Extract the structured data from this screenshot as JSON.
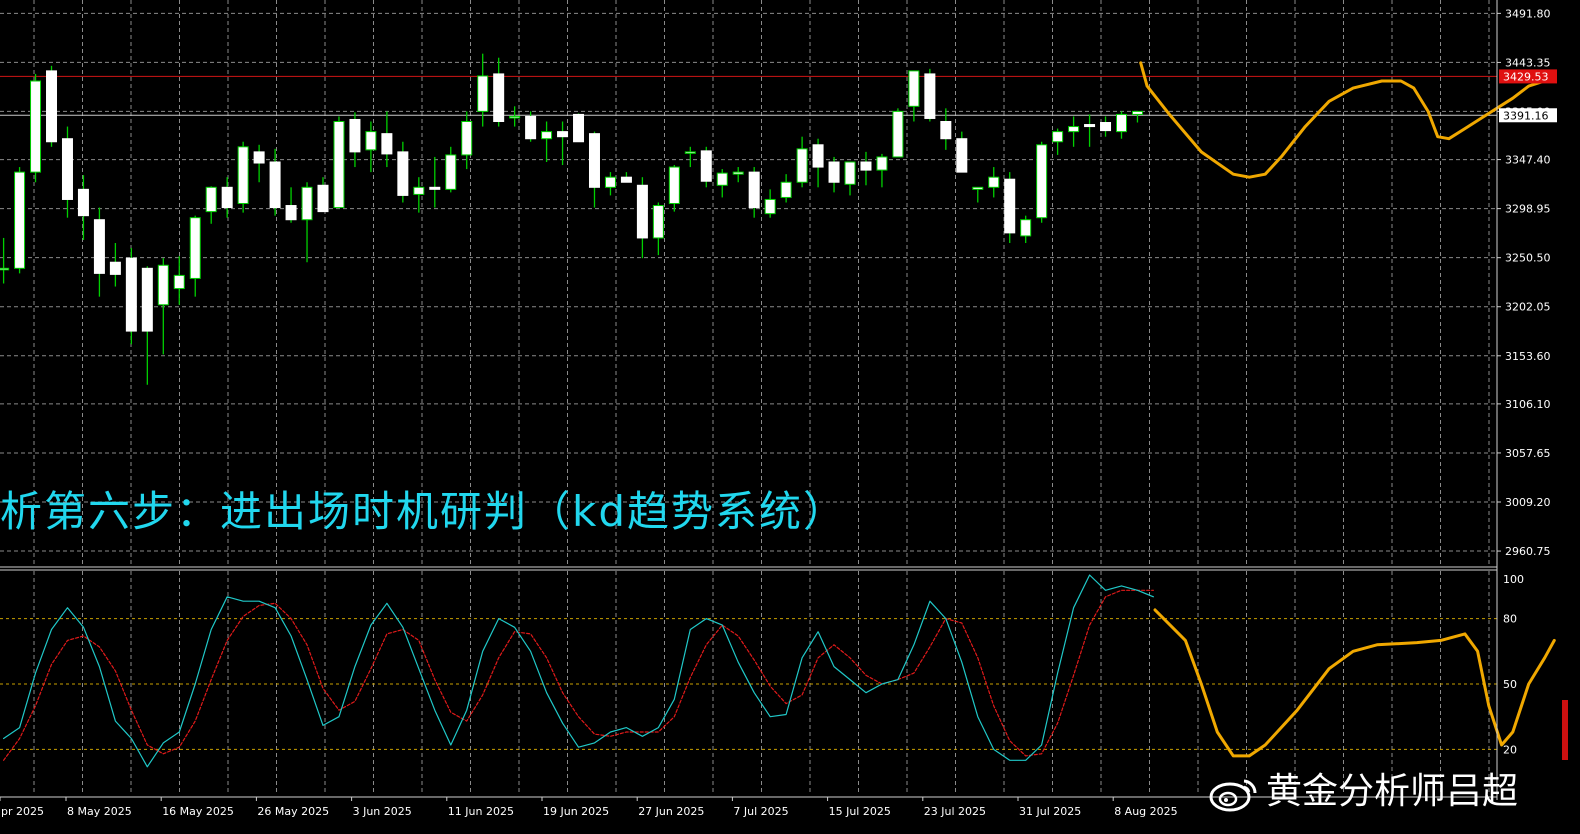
{
  "caption": "析第六步：进出场时机研判（kd趋势系统）",
  "watermark": "黄金分析师吕超",
  "watermark_logo": "weibo-logo",
  "colors": {
    "background": "#000000",
    "grid": "#8a8a8a",
    "bull_candle": "#ffffff",
    "bear_candle": "#ffffff",
    "wick": "#00d000",
    "resistance_line": "#d01414",
    "current_price_line": "#c8c8c8",
    "projection": "#f0a800",
    "k_line": "#20c8c8",
    "d_line": "#e01a1a",
    "caption": "#21d7ee"
  },
  "chart_data": [
    {
      "type": "candlestick",
      "y_ticks": [
        "3491.80",
        "3443.35",
        "3395.00",
        "3347.40",
        "3298.95",
        "3250.50",
        "3202.05",
        "3153.60",
        "3106.10",
        "3057.65",
        "3009.20",
        "2960.75"
      ],
      "ylim": [
        2945,
        3505
      ],
      "price_labels": [
        {
          "value": 3429.53,
          "text": "3429.53",
          "kind": "resistance"
        },
        {
          "value": 3391.16,
          "text": "3391.16",
          "kind": "current"
        }
      ],
      "x_labels": [
        "pr 2025",
        "8 May 2025",
        "16 May 2025",
        "26 May 2025",
        "3 Jun 2025",
        "11 Jun 2025",
        "19 Jun 2025",
        "27 Jun 2025",
        "7 Jul 2025",
        "15 Jul 2025",
        "23 Jul 2025",
        "31 Jul 2025",
        "8 Aug 2025"
      ],
      "candles": [
        {
          "o": 3240,
          "h": 3270,
          "l": 3225,
          "c": 3240
        },
        {
          "o": 3240,
          "h": 3340,
          "l": 3235,
          "c": 3335
        },
        {
          "o": 3335,
          "h": 3432,
          "l": 3325,
          "c": 3425
        },
        {
          "o": 3435,
          "h": 3440,
          "l": 3360,
          "c": 3365
        },
        {
          "o": 3368,
          "h": 3380,
          "l": 3290,
          "c": 3308
        },
        {
          "o": 3318,
          "h": 3332,
          "l": 3268,
          "c": 3292
        },
        {
          "o": 3288,
          "h": 3300,
          "l": 3212,
          "c": 3235
        },
        {
          "o": 3246,
          "h": 3265,
          "l": 3222,
          "c": 3234
        },
        {
          "o": 3250,
          "h": 3260,
          "l": 3165,
          "c": 3178
        },
        {
          "o": 3240,
          "h": 3242,
          "l": 3125,
          "c": 3178
        },
        {
          "o": 3204,
          "h": 3250,
          "l": 3155,
          "c": 3243
        },
        {
          "o": 3220,
          "h": 3252,
          "l": 3204,
          "c": 3233
        },
        {
          "o": 3230,
          "h": 3292,
          "l": 3212,
          "c": 3290
        },
        {
          "o": 3296,
          "h": 3321,
          "l": 3284,
          "c": 3320
        },
        {
          "o": 3320,
          "h": 3330,
          "l": 3290,
          "c": 3300
        },
        {
          "o": 3304,
          "h": 3365,
          "l": 3295,
          "c": 3360
        },
        {
          "o": 3355,
          "h": 3362,
          "l": 3325,
          "c": 3344
        },
        {
          "o": 3345,
          "h": 3358,
          "l": 3292,
          "c": 3300
        },
        {
          "o": 3302,
          "h": 3320,
          "l": 3285,
          "c": 3288
        },
        {
          "o": 3288,
          "h": 3325,
          "l": 3246,
          "c": 3320
        },
        {
          "o": 3322,
          "h": 3330,
          "l": 3296,
          "c": 3296
        },
        {
          "o": 3300,
          "h": 3390,
          "l": 3300,
          "c": 3385
        },
        {
          "o": 3387,
          "h": 3394,
          "l": 3340,
          "c": 3355
        },
        {
          "o": 3357,
          "h": 3385,
          "l": 3335,
          "c": 3375
        },
        {
          "o": 3373,
          "h": 3395,
          "l": 3340,
          "c": 3353
        },
        {
          "o": 3355,
          "h": 3365,
          "l": 3305,
          "c": 3312
        },
        {
          "o": 3313,
          "h": 3330,
          "l": 3295,
          "c": 3320
        },
        {
          "o": 3320,
          "h": 3350,
          "l": 3300,
          "c": 3318
        },
        {
          "o": 3318,
          "h": 3360,
          "l": 3315,
          "c": 3352
        },
        {
          "o": 3352,
          "h": 3395,
          "l": 3338,
          "c": 3385
        },
        {
          "o": 3395,
          "h": 3452,
          "l": 3380,
          "c": 3430
        },
        {
          "o": 3432,
          "h": 3448,
          "l": 3380,
          "c": 3385
        },
        {
          "o": 3390,
          "h": 3400,
          "l": 3380,
          "c": 3390
        },
        {
          "o": 3390,
          "h": 3395,
          "l": 3365,
          "c": 3368
        },
        {
          "o": 3368,
          "h": 3385,
          "l": 3345,
          "c": 3375
        },
        {
          "o": 3375,
          "h": 3385,
          "l": 3342,
          "c": 3370
        },
        {
          "o": 3392,
          "h": 3393,
          "l": 3365,
          "c": 3365
        },
        {
          "o": 3373,
          "h": 3375,
          "l": 3300,
          "c": 3320
        },
        {
          "o": 3320,
          "h": 3335,
          "l": 3312,
          "c": 3330
        },
        {
          "o": 3330,
          "h": 3335,
          "l": 3325,
          "c": 3325
        },
        {
          "o": 3322,
          "h": 3330,
          "l": 3250,
          "c": 3270
        },
        {
          "o": 3270,
          "h": 3305,
          "l": 3253,
          "c": 3302
        },
        {
          "o": 3304,
          "h": 3342,
          "l": 3296,
          "c": 3340
        },
        {
          "o": 3355,
          "h": 3360,
          "l": 3340,
          "c": 3355
        },
        {
          "o": 3356,
          "h": 3360,
          "l": 3320,
          "c": 3326
        },
        {
          "o": 3322,
          "h": 3338,
          "l": 3310,
          "c": 3334
        },
        {
          "o": 3333,
          "h": 3340,
          "l": 3325,
          "c": 3335
        },
        {
          "o": 3335,
          "h": 3340,
          "l": 3290,
          "c": 3300
        },
        {
          "o": 3294,
          "h": 3318,
          "l": 3290,
          "c": 3308
        },
        {
          "o": 3310,
          "h": 3333,
          "l": 3305,
          "c": 3325
        },
        {
          "o": 3325,
          "h": 3370,
          "l": 3320,
          "c": 3358
        },
        {
          "o": 3362,
          "h": 3368,
          "l": 3320,
          "c": 3340
        },
        {
          "o": 3345,
          "h": 3350,
          "l": 3315,
          "c": 3325
        },
        {
          "o": 3323,
          "h": 3345,
          "l": 3312,
          "c": 3345
        },
        {
          "o": 3345,
          "h": 3355,
          "l": 3322,
          "c": 3337
        },
        {
          "o": 3337,
          "h": 3353,
          "l": 3320,
          "c": 3350
        },
        {
          "o": 3350,
          "h": 3398,
          "l": 3350,
          "c": 3395
        },
        {
          "o": 3400,
          "h": 3434,
          "l": 3385,
          "c": 3435
        },
        {
          "o": 3432,
          "h": 3437,
          "l": 3385,
          "c": 3388
        },
        {
          "o": 3385,
          "h": 3398,
          "l": 3357,
          "c": 3368
        },
        {
          "o": 3368,
          "h": 3375,
          "l": 3335,
          "c": 3335
        },
        {
          "o": 3318,
          "h": 3320,
          "l": 3305,
          "c": 3320
        },
        {
          "o": 3320,
          "h": 3340,
          "l": 3310,
          "c": 3330
        },
        {
          "o": 3328,
          "h": 3335,
          "l": 3265,
          "c": 3275
        },
        {
          "o": 3272,
          "h": 3292,
          "l": 3265,
          "c": 3288
        },
        {
          "o": 3290,
          "h": 3365,
          "l": 3285,
          "c": 3362
        },
        {
          "o": 3365,
          "h": 3378,
          "l": 3352,
          "c": 3375
        },
        {
          "o": 3375,
          "h": 3390,
          "l": 3360,
          "c": 3380
        },
        {
          "o": 3382,
          "h": 3392,
          "l": 3360,
          "c": 3380
        },
        {
          "o": 3384,
          "h": 3390,
          "l": 3370,
          "c": 3376
        },
        {
          "o": 3375,
          "h": 3395,
          "l": 3368,
          "c": 3392
        },
        {
          "o": 3392,
          "h": 3395,
          "l": 3384,
          "c": 3395
        }
      ],
      "projection": [
        {
          "i": 71.2,
          "p": 3443
        },
        {
          "i": 71.6,
          "p": 3420
        },
        {
          "i": 73,
          "p": 3392
        },
        {
          "i": 75,
          "p": 3355
        },
        {
          "i": 77,
          "p": 3333
        },
        {
          "i": 78,
          "p": 3330
        },
        {
          "i": 79,
          "p": 3333
        },
        {
          "i": 80,
          "p": 3350
        },
        {
          "i": 81.5,
          "p": 3380
        },
        {
          "i": 83,
          "p": 3405
        },
        {
          "i": 84.5,
          "p": 3418
        },
        {
          "i": 86.3,
          "p": 3425
        },
        {
          "i": 87.5,
          "p": 3425
        },
        {
          "i": 88.3,
          "p": 3418
        },
        {
          "i": 89.2,
          "p": 3395
        },
        {
          "i": 89.8,
          "p": 3370
        },
        {
          "i": 90.5,
          "p": 3368
        },
        {
          "i": 91.5,
          "p": 3378
        },
        {
          "i": 93,
          "p": 3393
        },
        {
          "i": 94.5,
          "p": 3408
        },
        {
          "i": 95.5,
          "p": 3420
        },
        {
          "i": 96.3,
          "p": 3424
        }
      ]
    },
    {
      "type": "line",
      "name": "KD",
      "ylim": [
        0,
        100
      ],
      "y_ticks": [
        100,
        80,
        50,
        20
      ],
      "ref_lines": [
        80,
        50,
        20
      ],
      "k": [
        25,
        30,
        55,
        75,
        85,
        76,
        58,
        33,
        25,
        12,
        23,
        28,
        50,
        75,
        90,
        88,
        88,
        85,
        72,
        52,
        31,
        35,
        58,
        77,
        87,
        76,
        57,
        38,
        22,
        38,
        65,
        80,
        76,
        65,
        46,
        32,
        21,
        23,
        28,
        30,
        26,
        30,
        43,
        75,
        80,
        77,
        60,
        46,
        35,
        36,
        62,
        74,
        58,
        52,
        46,
        50,
        52,
        68,
        88,
        80,
        60,
        35,
        20,
        15,
        15,
        22,
        55,
        85,
        100,
        93,
        95,
        93,
        90
      ],
      "d": [
        15,
        25,
        40,
        59,
        70,
        72,
        67,
        56,
        38,
        22,
        18,
        21,
        33,
        52,
        70,
        81,
        86,
        87,
        80,
        68,
        48,
        38,
        42,
        57,
        73,
        75,
        70,
        52,
        37,
        33,
        45,
        62,
        74,
        73,
        62,
        46,
        35,
        27,
        26,
        28,
        28,
        28,
        35,
        53,
        68,
        77,
        72,
        61,
        49,
        41,
        45,
        62,
        68,
        62,
        54,
        50,
        52,
        55,
        67,
        80,
        78,
        62,
        40,
        24,
        17,
        18,
        32,
        54,
        77,
        90,
        93,
        93,
        93
      ],
      "projection": [
        {
          "i": 72.1,
          "v": 84
        },
        {
          "i": 74,
          "v": 70
        },
        {
          "i": 75,
          "v": 50
        },
        {
          "i": 76,
          "v": 28
        },
        {
          "i": 77,
          "v": 17
        },
        {
          "i": 78,
          "v": 17
        },
        {
          "i": 79,
          "v": 22
        },
        {
          "i": 81,
          "v": 38
        },
        {
          "i": 83,
          "v": 57
        },
        {
          "i": 84.5,
          "v": 65
        },
        {
          "i": 86,
          "v": 68
        },
        {
          "i": 88.5,
          "v": 69
        },
        {
          "i": 90,
          "v": 70
        },
        {
          "i": 91.5,
          "v": 73
        },
        {
          "i": 92.3,
          "v": 65
        },
        {
          "i": 93,
          "v": 40
        },
        {
          "i": 93.8,
          "v": 22
        },
        {
          "i": 94.5,
          "v": 28
        },
        {
          "i": 95.5,
          "v": 50
        },
        {
          "i": 96.5,
          "v": 62
        },
        {
          "i": 97.1,
          "v": 70
        }
      ]
    }
  ]
}
